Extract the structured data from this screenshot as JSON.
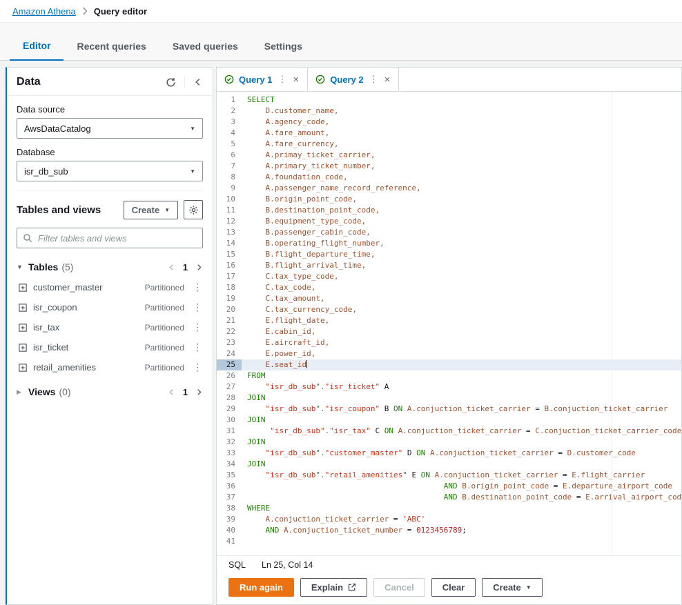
{
  "breadcrumb": {
    "root": "Amazon Athena",
    "current": "Query editor"
  },
  "nav_tabs": [
    {
      "label": "Editor",
      "active": true
    },
    {
      "label": "Recent queries",
      "active": false
    },
    {
      "label": "Saved queries",
      "active": false
    },
    {
      "label": "Settings",
      "active": false
    }
  ],
  "icons": {
    "caret_down": "▼",
    "caret_right": "▶",
    "kebab": "⋮",
    "close": "×"
  },
  "sidebar": {
    "title": "Data",
    "data_source": {
      "label": "Data source",
      "value": "AwsDataCatalog"
    },
    "database": {
      "label": "Database",
      "value": "isr_db_sub"
    },
    "tables_and_views": {
      "title": "Tables and views",
      "create_button": "Create",
      "filter_placeholder": "Filter tables and views"
    },
    "tables_section": {
      "label": "Tables",
      "count": "(5)",
      "page": "1"
    },
    "tables": [
      {
        "name": "customer_master",
        "badge": "Partitioned"
      },
      {
        "name": "isr_coupon",
        "badge": "Partitioned"
      },
      {
        "name": "isr_tax",
        "badge": "Partitioned"
      },
      {
        "name": "isr_ticket",
        "badge": "Partitioned"
      },
      {
        "name": "retail_amenities",
        "badge": "Partitioned"
      }
    ],
    "views_section": {
      "label": "Views",
      "count": "(0)",
      "page": "1"
    }
  },
  "editor": {
    "query_tabs": [
      {
        "label": "Query 1",
        "active": true
      },
      {
        "label": "Query 2",
        "active": false
      }
    ],
    "active_line": 25,
    "code_lines": [
      "SELECT",
      "    D.customer_name,",
      "    A.agency_code,",
      "    A.fare_amount,",
      "    A.fare_currency,",
      "    A.primay_ticket_carrier,",
      "    A.primary_ticket_number,",
      "    A.foundation_code,",
      "    A.passenger_name_record_reference,",
      "    B.origin_point_code,",
      "    B.destination_point_code,",
      "    B.equipment_type_code,",
      "    B.passenger_cabin_code,",
      "    B.operating_flight_number,",
      "    B.flight_departure_time,",
      "    B.flight_arrival_time,",
      "    C.tax_type_code,",
      "    C.tax_code,",
      "    C.tax_amount,",
      "    C.tax_currency_code,",
      "    E.flight_date,",
      "    E.cabin_id,",
      "    E.aircraft_id,",
      "    E.power_id,",
      "    E.seat_id",
      "FROM",
      "    \"isr_db_sub\".\"isr_ticket\" A",
      "JOIN",
      "    \"isr_db_sub\".\"isr_coupon\" B ON A.conjuction_ticket_carrier = B.conjuction_ticket_carrier",
      "JOIN",
      "     \"isr_db_sub\".\"isr_tax\" C ON A.conjuction_ticket_carrier = C.conjuction_ticket_carrier_code",
      "JOIN",
      "    \"isr_db_sub\".\"customer_master\" D ON A.conjuction_ticket_carrier = D.customer_code",
      "JOIN",
      "    \"isr_db_sub\".\"retail_amenities\" E ON A.conjuction_ticket_carrier = E.flight_carrier",
      "                                           AND B.origin_point_code = E.departure_airport_code",
      "                                           AND B.destination_point_code = E.arrival_airport_code",
      "WHERE",
      "    A.conjuction_ticket_carrier = 'ABC'",
      "    AND A.conjuction_ticket_number = 0123456789;",
      ""
    ],
    "status": {
      "language": "SQL",
      "position": "Ln 25, Col 14"
    },
    "buttons": {
      "run": "Run again",
      "explain": "Explain",
      "cancel": "Cancel",
      "clear": "Clear",
      "create": "Create"
    }
  },
  "colors": {
    "accent_blue": "#0073bb",
    "primary_orange": "#ec7211",
    "keyword_green": "#1d8102",
    "identifier_brown": "#a0522d",
    "string_red": "#d13212",
    "number_maroon": "#b22222"
  }
}
